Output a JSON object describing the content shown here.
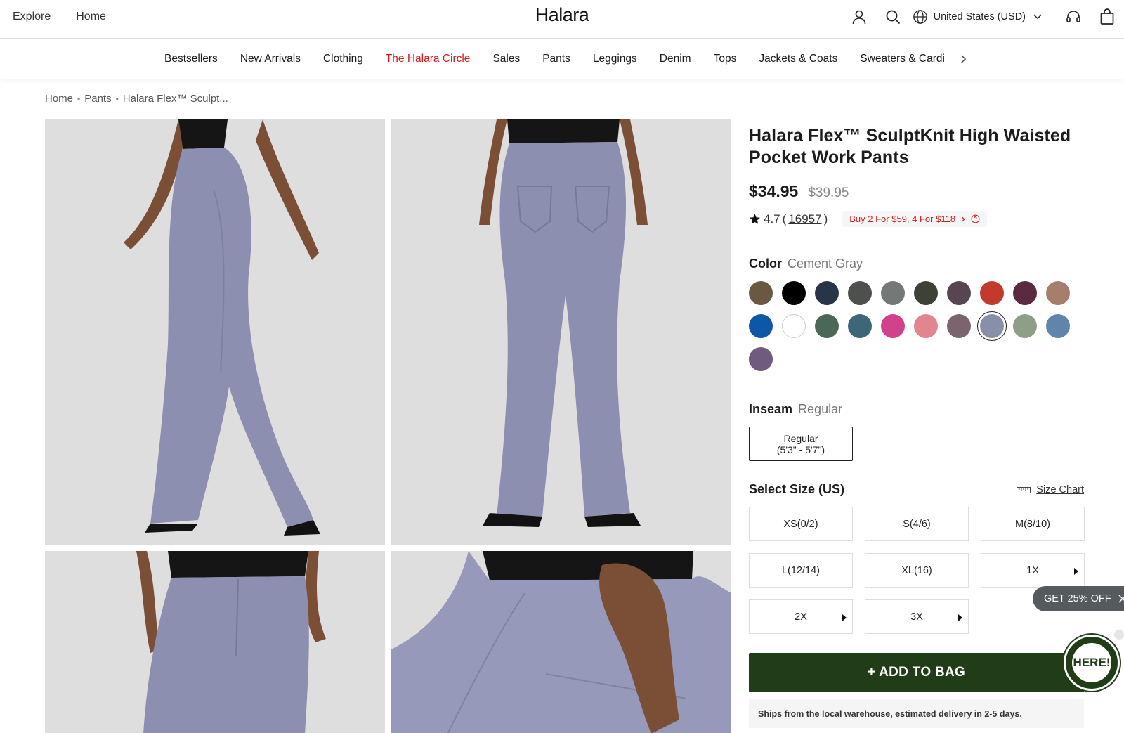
{
  "header": {
    "nav_left": [
      "Explore",
      "Home"
    ],
    "logo": "Halara",
    "region": "United States (USD)"
  },
  "categories": [
    "Bestsellers",
    "New Arrivals",
    "Clothing",
    "The Halara Circle",
    "Sales",
    "Pants",
    "Leggings",
    "Denim",
    "Tops",
    "Jackets & Coats",
    "Sweaters & Cardi"
  ],
  "breadcrumb": {
    "home": "Home",
    "pants": "Pants",
    "current": "Halara Flex™ Sculpt..."
  },
  "product": {
    "title": "Halara Flex™ SculptKnit High Waisted Pocket Work Pants",
    "price": "$34.95",
    "old_price": "$39.95",
    "rating": "4.7",
    "review_count": "16957",
    "promo": "Buy 2 For $59, 4 For $118"
  },
  "color": {
    "label": "Color",
    "selected": "Cement Gray",
    "swatches": [
      "#6b5843",
      "#000000",
      "#283447",
      "#4d504d",
      "#747877",
      "#3e4135",
      "#584552",
      "#c23a2c",
      "#5b2a40",
      "#a57e6e",
      "#0e57a6",
      "#ffffff",
      "#4b6856",
      "#3d6777",
      "#d2428c",
      "#e3858d",
      "#7a656f",
      "#8790a8",
      "#8f9e86",
      "#5f86aa",
      "#6e5b7d"
    ],
    "selected_index": 17
  },
  "inseam": {
    "label": "Inseam",
    "selected": "Regular",
    "option_name": "Regular",
    "option_range": "(5'3\" - 5'7\")"
  },
  "size": {
    "label": "Select Size (US)",
    "chart_link": "Size Chart",
    "options": [
      {
        "label": "XS(0/2)",
        "more": false
      },
      {
        "label": "S(4/6)",
        "more": false
      },
      {
        "label": "M(8/10)",
        "more": false
      },
      {
        "label": "L(12/14)",
        "more": false
      },
      {
        "label": "XL(16)",
        "more": false
      },
      {
        "label": "1X",
        "more": true
      },
      {
        "label": "2X",
        "more": true
      },
      {
        "label": "3X",
        "more": true
      }
    ]
  },
  "cta": {
    "add_to_bag": "+ ADD TO BAG",
    "shipping": "Ships from the local warehouse, estimated delivery in 2-5 days."
  },
  "floating": {
    "discount": "GET 25% OFF",
    "gift": "HERE!"
  }
}
